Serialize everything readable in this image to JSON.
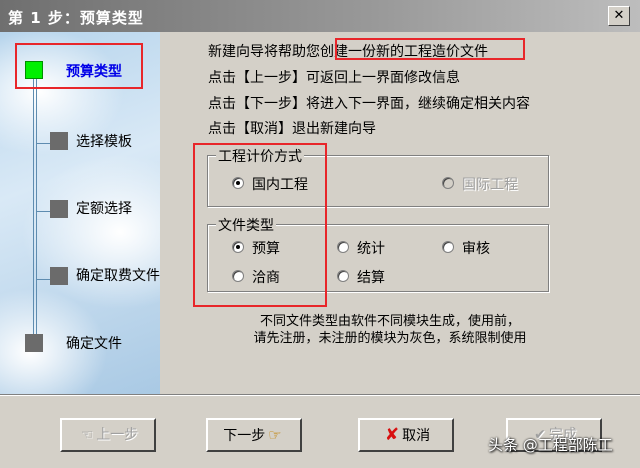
{
  "window": {
    "title": "第 1 步：预算类型",
    "close_glyph": "✕"
  },
  "steps": [
    {
      "label": "预算类型",
      "current": true
    },
    {
      "label": "选择模板",
      "current": false
    },
    {
      "label": "定额选择",
      "current": false
    },
    {
      "label": "确定取费文件",
      "current": false
    },
    {
      "label": "确定文件",
      "current": false
    }
  ],
  "intro": {
    "line1_prefix": "新建向导将帮助您",
    "line1_highlight": "创建一份新的工程造价文件",
    "line2": "点击【上一步】可返回上一界面修改信息",
    "line3": "点击【下一步】将进入下一界面，继续确定相关内容",
    "line4": "点击【取消】退出新建向导"
  },
  "pricing_group": {
    "legend": "工程计价方式",
    "options": [
      {
        "label": "国内工程",
        "checked": true,
        "disabled": false
      },
      {
        "label": "国际工程",
        "checked": false,
        "disabled": true
      }
    ]
  },
  "filetype_group": {
    "legend": "文件类型",
    "options": [
      {
        "label": "预算",
        "checked": true
      },
      {
        "label": "统计",
        "checked": false
      },
      {
        "label": "审核",
        "checked": false
      },
      {
        "label": "洽商",
        "checked": false
      },
      {
        "label": "结算",
        "checked": false
      }
    ]
  },
  "note": {
    "line1": "不同文件类型由软件不同模块生成，使用前，",
    "line2": "请先注册，未注册的模块为灰色，系统限制使用"
  },
  "buttons": {
    "prev": "上一步",
    "next": "下一步",
    "cancel": "取消",
    "finish": "完成"
  },
  "watermark": "头条 @工程部陈工",
  "colors": {
    "highlight_red": "#e8262a",
    "current_step": "#00f000",
    "current_step_text": "#0000e8"
  }
}
